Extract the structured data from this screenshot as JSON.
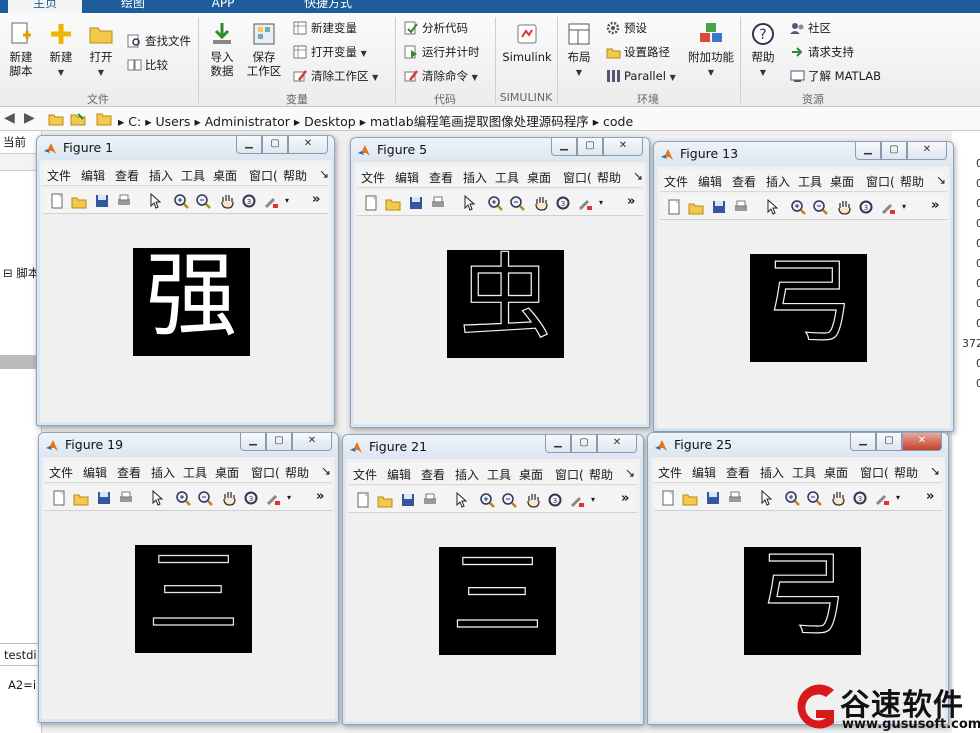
{
  "tabs": [
    {
      "label": "主页",
      "active": true
    },
    {
      "label": "绘图",
      "active": false
    },
    {
      "label": "APP",
      "active": false
    },
    {
      "label": "快捷方式",
      "active": false
    }
  ],
  "ribbon": {
    "new_script": "新建\n脚本",
    "new": "新建",
    "open": "打开",
    "find_files": "查找文件",
    "compare": "比较",
    "import_data": "导入\n数据",
    "save_workspace": "保存\n工作区",
    "new_variable": "新建变量",
    "open_variable": "打开变量",
    "clear_workspace": "清除工作区",
    "analyze_code": "分析代码",
    "run_and_time": "运行并计时",
    "clear_commands": "清除命令",
    "simulink": "Simulink",
    "layout": "布局",
    "preferences": "预设",
    "set_path": "设置路径",
    "parallel": "Parallel",
    "addons": "附加功能",
    "help": "帮助",
    "community": "社区",
    "request_support": "请求支持",
    "learn_matlab": "了解 MATLAB",
    "groups": {
      "file": "文件",
      "variable": "变量",
      "code": "代码",
      "simulink": "SIMULINK",
      "environment": "环境",
      "resources": "资源"
    }
  },
  "address": {
    "segments": [
      "C:",
      "Users",
      "Administrator",
      "Desktop",
      "matlab编程笔画提取图像处理源码程序",
      "code"
    ]
  },
  "background": {
    "left_labels": [
      "当前",
      "脚本",
      "testdi",
      "A2=i"
    ],
    "right_numbers": [
      "0",
      "0",
      "0",
      "0",
      "0",
      "0",
      "0",
      "0",
      "0",
      "372",
      "0",
      "0"
    ]
  },
  "figure_menu": [
    "文件",
    "编辑",
    "查看",
    "插入",
    "工具",
    "桌面",
    "窗口(",
    "帮助",
    "↘"
  ],
  "figure_toolbar_overflow": "»",
  "figures": [
    {
      "title": "Figure 1",
      "glyph": "强"
    },
    {
      "title": "Figure 5",
      "glyph": "虫"
    },
    {
      "title": "Figure 13",
      "glyph": "弓"
    },
    {
      "title": "Figure 19",
      "glyph": "三"
    },
    {
      "title": "Figure 21",
      "glyph": "三"
    },
    {
      "title": "Figure 25",
      "glyph": "弓"
    }
  ],
  "watermark": {
    "name": "谷速软件",
    "url": "www.gususoft.com"
  },
  "colors": {
    "tab_bar": "#1d5d9b",
    "matlab_orange": "#e8731b",
    "watermark_red": "#d7191c"
  }
}
